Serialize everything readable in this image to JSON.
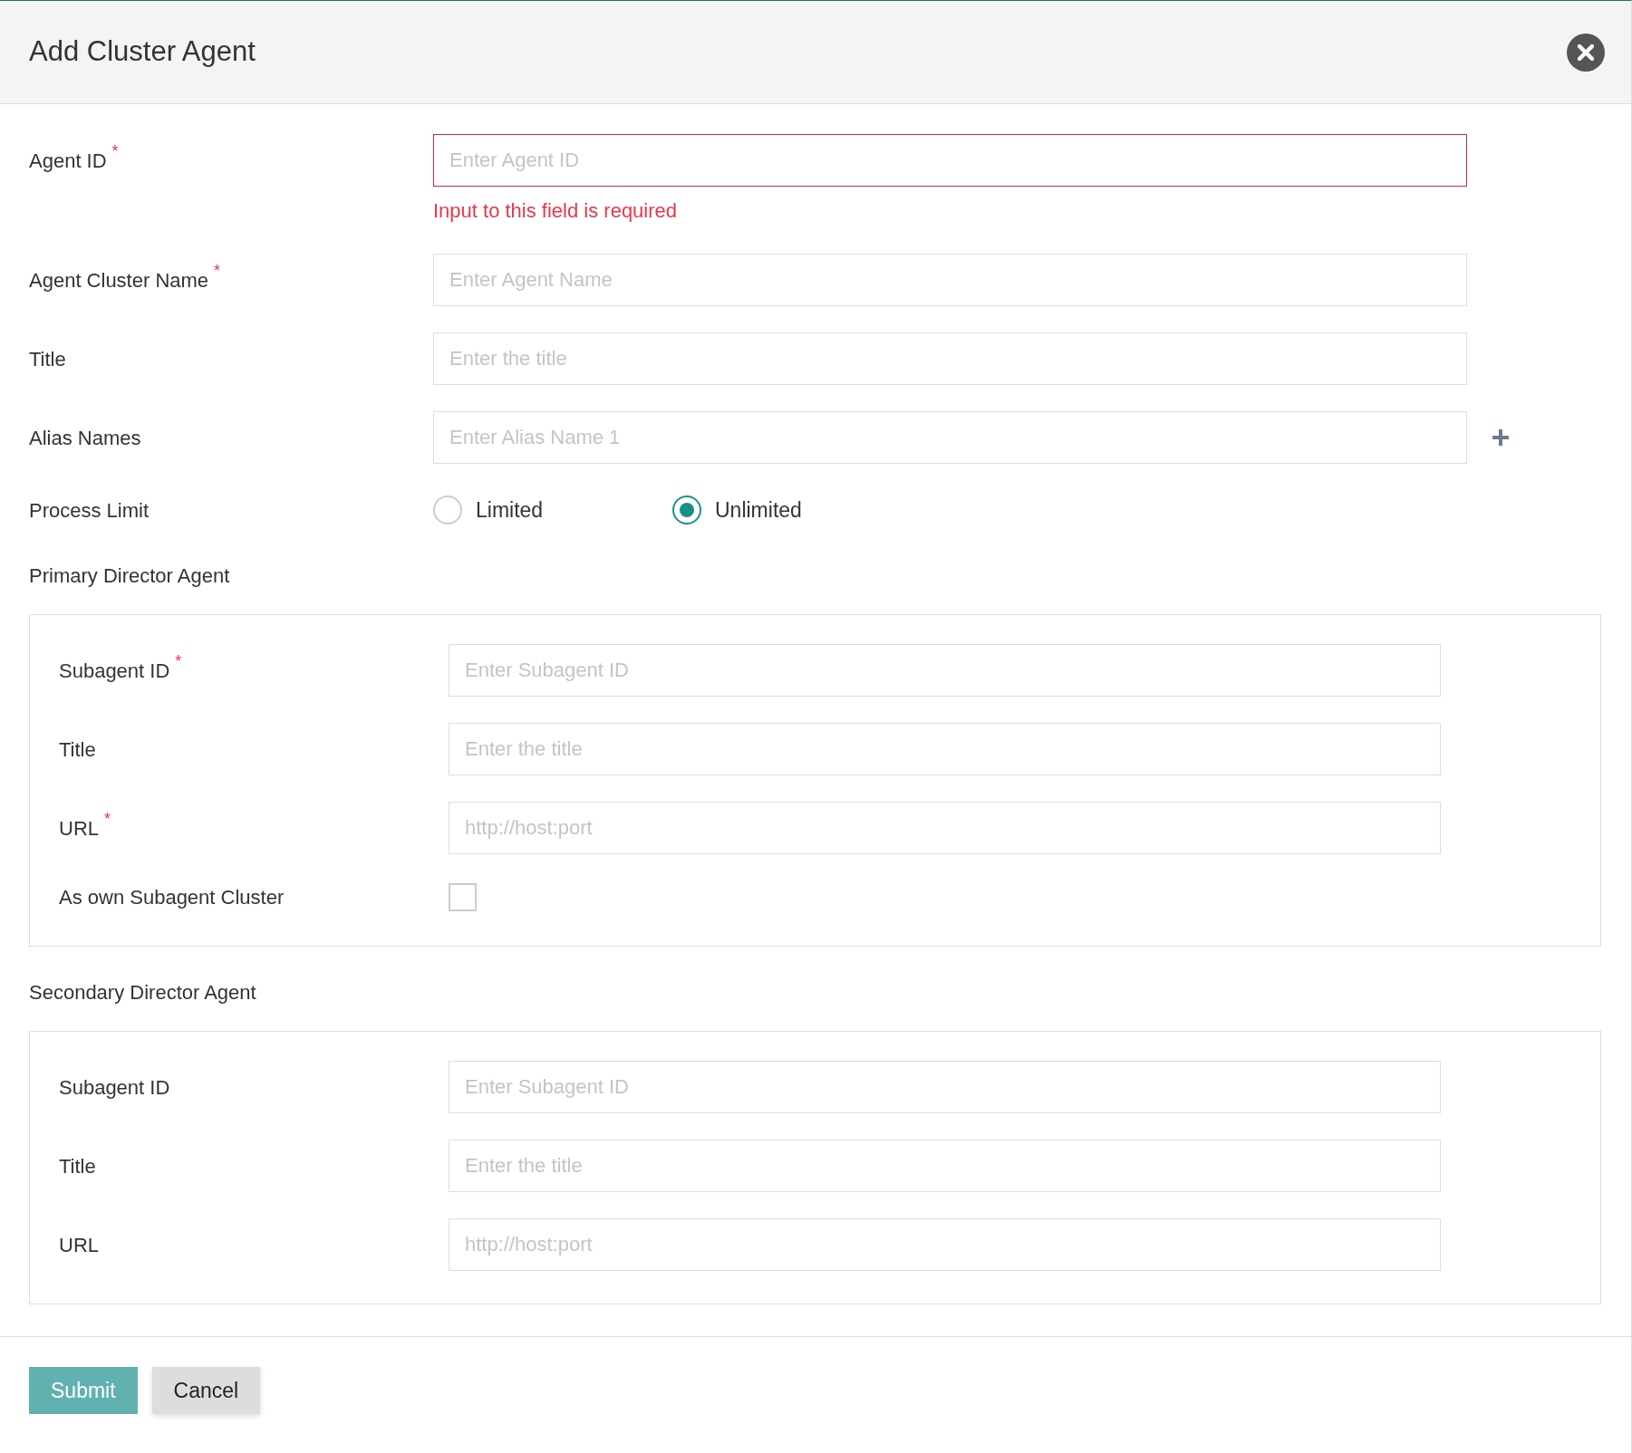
{
  "dialog": {
    "title": "Add Cluster Agent"
  },
  "fields": [
    {
      "kind": "text",
      "label": "Agent ID",
      "required_mark": "*",
      "placeholder": "Enter Agent ID",
      "invalid": true,
      "error": "Input to this field is required"
    },
    {
      "kind": "text",
      "label": "Agent Cluster Name",
      "required_mark": "*",
      "placeholder": "Enter Agent Name",
      "invalid": false
    },
    {
      "kind": "text",
      "label": "Title",
      "placeholder": "Enter the title",
      "invalid": false
    },
    {
      "kind": "alias",
      "label": "Alias Names",
      "placeholder": "Enter Alias Name 1",
      "invalid": false
    },
    {
      "kind": "radio",
      "label": "Process Limit",
      "options": [
        {
          "label": "Limited",
          "selected": false
        },
        {
          "label": "Unlimited",
          "selected": true
        }
      ]
    }
  ],
  "sections": [
    {
      "title": "Primary Director Agent",
      "fields": [
        {
          "kind": "text",
          "label": "Subagent ID",
          "required_mark": "*",
          "placeholder": "Enter Subagent ID",
          "invalid": false
        },
        {
          "kind": "text",
          "label": "Title",
          "placeholder": "Enter the title",
          "invalid": false
        },
        {
          "kind": "text",
          "label": "URL",
          "required_mark": "*",
          "placeholder": "http://host:port",
          "invalid": false
        },
        {
          "kind": "checkbox",
          "label": "As own Subagent Cluster",
          "checked": false
        }
      ]
    },
    {
      "title": "Secondary Director Agent",
      "fields": [
        {
          "kind": "text",
          "label": "Subagent ID",
          "placeholder": "Enter Subagent ID",
          "invalid": false
        },
        {
          "kind": "text",
          "label": "Title",
          "placeholder": "Enter the title",
          "invalid": false
        },
        {
          "kind": "text",
          "label": "URL",
          "placeholder": "http://host:port",
          "invalid": false
        }
      ]
    }
  ],
  "buttons": [
    {
      "label": "Submit",
      "kind": "primary"
    },
    {
      "label": "Cancel",
      "kind": "secondary"
    }
  ]
}
